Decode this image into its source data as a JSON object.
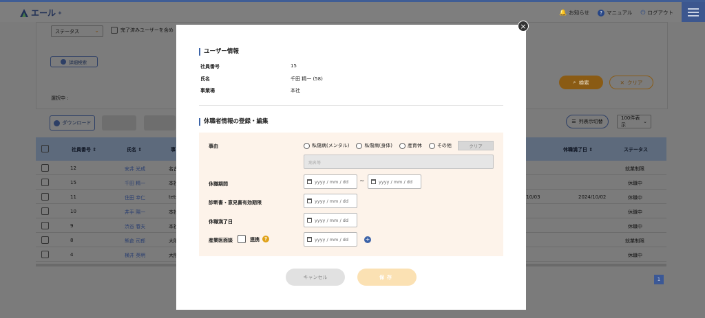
{
  "header": {
    "logo_text": "エール",
    "logo_sup": "+",
    "links": [
      {
        "label": "お知らせ",
        "icon": "bell-icon"
      },
      {
        "label": "マニュアル",
        "icon": "question-icon"
      },
      {
        "label": "ログアウト",
        "icon": "power-icon"
      }
    ]
  },
  "search_panel": {
    "status_select": "ステータス",
    "include_done_label": "完了済みユーザーを含め",
    "detail_search": "詳細検索",
    "selected_label": "選択中 :",
    "search_button": "検索",
    "clear_button": "クリア"
  },
  "toolbar": {
    "download": "ダウンロード",
    "delete": "削除",
    "column_display": "列表示切替",
    "page_size": "100件表示"
  },
  "table": {
    "headers": {
      "employee_no": "社員番号 ⇕",
      "name": "氏名 ⇕",
      "site": "事",
      "leave_end": "休職満了日 ⇕",
      "status": "ステータス"
    },
    "rows": [
      {
        "no": "12",
        "name": "安井 光成",
        "site": "名古",
        "c1": "",
        "c2": "",
        "status": "就業制限"
      },
      {
        "no": "15",
        "name": "千田 精一",
        "site": "本社",
        "c1": "",
        "c2": "",
        "status": "休職中"
      },
      {
        "no": "11",
        "name": "住田 幸仁",
        "site": "tets",
        "c1": "/10/03",
        "c2": "2024/10/02",
        "status": "休職中"
      },
      {
        "no": "10",
        "name": "井手 陽一",
        "site": "本社",
        "c1": "",
        "c2": "",
        "status": "休職中"
      },
      {
        "no": "9",
        "name": "渋谷 春夫",
        "site": "本社",
        "c1": "",
        "c2": "",
        "status": "休職中"
      },
      {
        "no": "8",
        "name": "熊倉 司郎",
        "site": "大阪",
        "c1": "",
        "c2": "",
        "status": "就業制限"
      },
      {
        "no": "4",
        "name": "横井 英明",
        "site": "大阪",
        "c1": "",
        "c2": "",
        "status": "休職中"
      }
    ],
    "page": "1"
  },
  "modal": {
    "user_section_title": "ユーザー情報",
    "employee_no_label": "社員番号",
    "employee_no_value": "15",
    "name_label": "氏名",
    "name_value": "千田 精一 (58)",
    "site_label": "事業場",
    "site_value": "本社",
    "leave_section_title": "休職者情報の登録・編集",
    "reason_label": "事由",
    "reason_options": [
      "私傷病(メンタル)",
      "私傷病(身体)",
      "産育休",
      "その他"
    ],
    "reason_clear": "クリア",
    "reason_placeholder": "病名等",
    "period_label": "休職期間",
    "period_tilde": "~",
    "certificate_label": "診断書・意見書有効期限",
    "leave_end_label": "休職満了日",
    "doctor_interview_label": "産業医面談",
    "link_label": "連携",
    "date_placeholder": "yyyy / mm / dd",
    "cancel": "キャンセル",
    "save": "保存"
  }
}
